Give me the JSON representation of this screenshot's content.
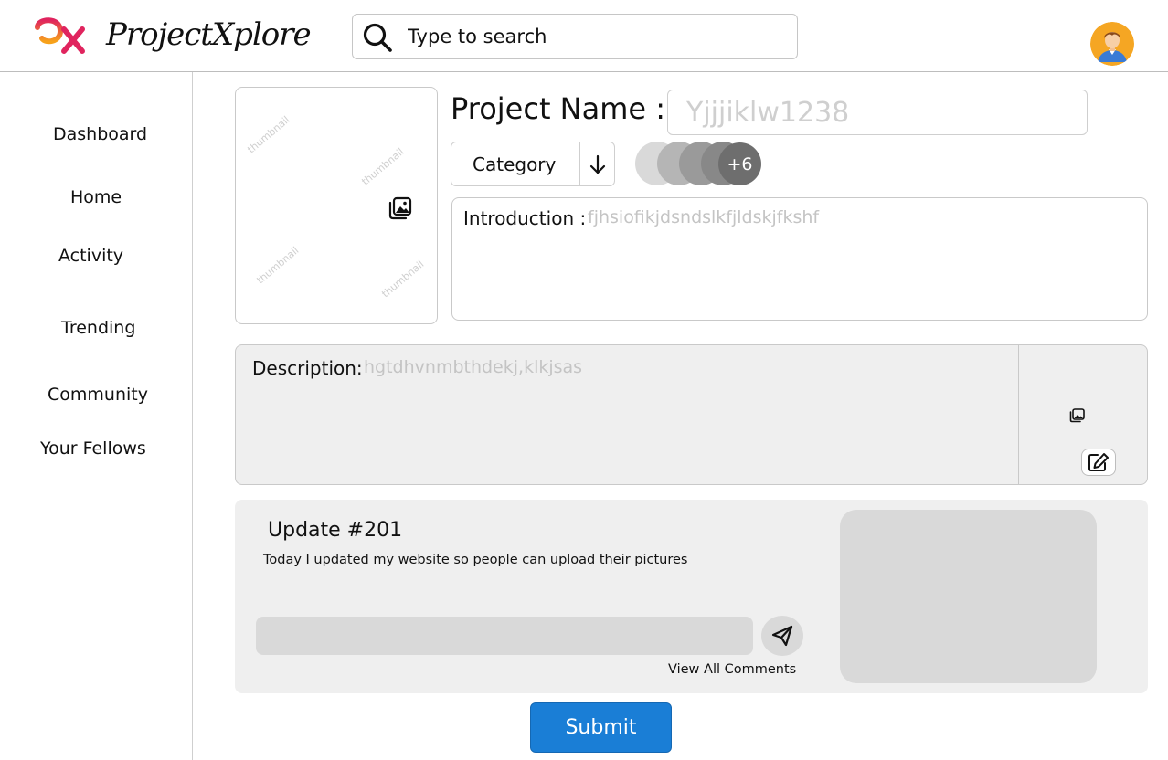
{
  "header": {
    "logo_mark": "px",
    "app_name": "ProjectXplore",
    "search": {
      "placeholder": "Type to search",
      "icon": "search-icon"
    },
    "avatar_icon": "user-avatar"
  },
  "sidebar": {
    "items": [
      {
        "label": "Dashboard"
      },
      {
        "label": "Home"
      },
      {
        "label": "Activity"
      },
      {
        "label": "Trending"
      },
      {
        "label": "Community"
      },
      {
        "label": "Your Fellows"
      }
    ]
  },
  "project": {
    "thumbnail": {
      "watermarks": [
        "thumbnail",
        "thumbnail",
        "thumbnail",
        "thumbnail"
      ],
      "icon": "image-gallery-icon"
    },
    "name_label": "Project Name :",
    "name_value": "Yjjjiklw1238",
    "category": {
      "label": "Category",
      "icon": "arrow-down-icon"
    },
    "members": {
      "more_label": "+6",
      "colors": [
        "#d9d9d9",
        "#b5b5b5",
        "#9a9a9a",
        "#888888",
        "#6e6e6e"
      ]
    },
    "introduction": {
      "label": "Introduction :",
      "value": "fjhsiofikjdsndslkfjldskjfkshf"
    },
    "description": {
      "label": "Description:",
      "value": "hgtdhvnmbthdekj,klkjsas",
      "image_icon": "image-gallery-icon",
      "edit_icon": "edit-icon"
    }
  },
  "update": {
    "title": "Update #201",
    "text": "Today I updated my website so people can upload their pictures",
    "comment_placeholder": "",
    "send_icon": "send-icon",
    "view_comments_label": "View All Comments"
  },
  "submit_label": "Submit",
  "colors": {
    "accent": "#1a7ed6",
    "panel": "#efefef",
    "placeholder": "#c4c4c4"
  }
}
